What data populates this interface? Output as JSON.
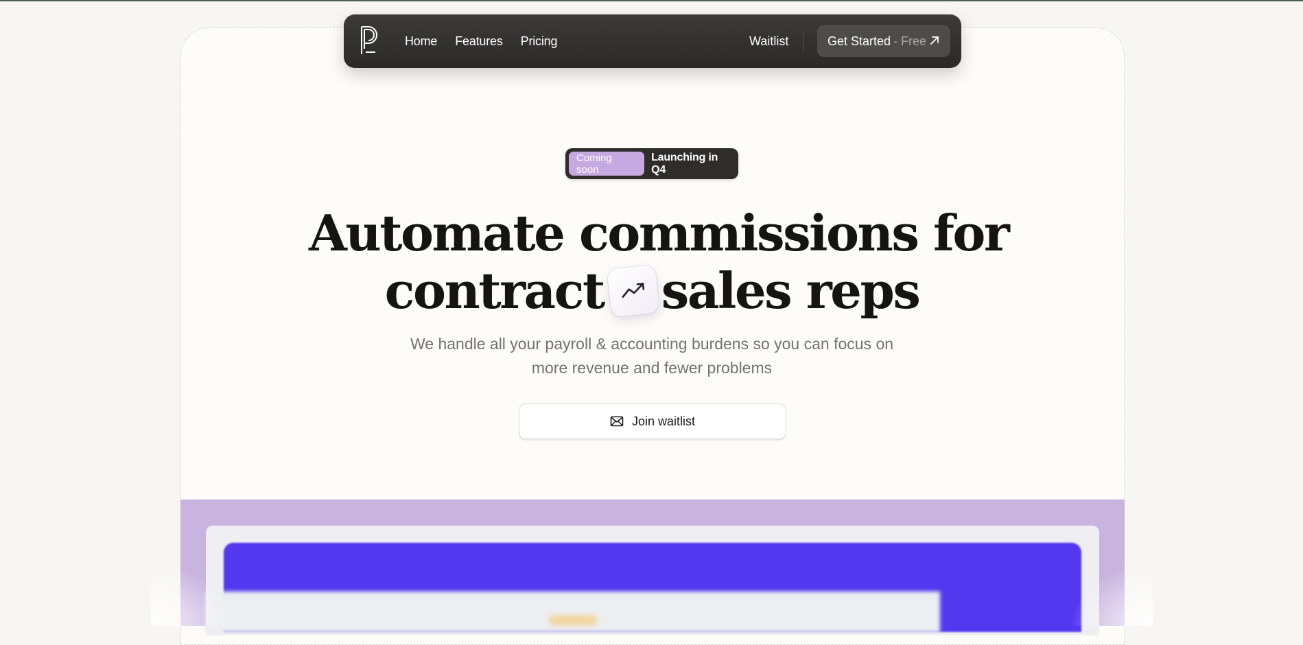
{
  "nav": {
    "logo_icon": "brand-logo-icon",
    "links": [
      {
        "label": "Home"
      },
      {
        "label": "Features"
      },
      {
        "label": "Pricing"
      }
    ],
    "waitlist_label": "Waitlist",
    "cta": {
      "label": "Get Started",
      "suffix": "- Free",
      "icon": "arrow-up-right-icon"
    }
  },
  "badge": {
    "pill": "Coming soon",
    "text": "Launching in Q4"
  },
  "hero": {
    "title_line1": "Automate commissions for",
    "title_line2_before": "contract",
    "title_line2_after": "sales reps",
    "inline_icon": "trending-up-icon",
    "subtitle_line1": "We handle all your payroll & accounting burdens so you can focus on",
    "subtitle_line2": "more revenue and fewer problems",
    "join_label": "Join waitlist",
    "join_icon": "mail-icon"
  },
  "colors": {
    "nav_bg": "#2f2e2d",
    "badge_pill": "#c5a9e0",
    "purple_region": "#c9b3df",
    "blue_banner": "#5438f0",
    "page_bg": "#fdfcf8"
  }
}
